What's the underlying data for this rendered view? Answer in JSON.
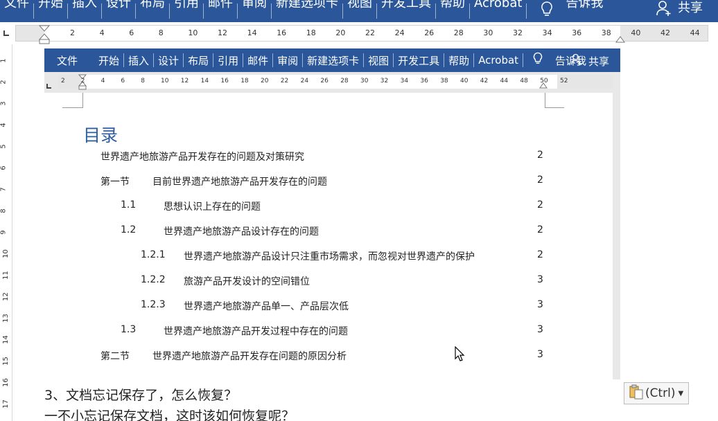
{
  "outer_ribbon": {
    "tabs": [
      "文件",
      "开始",
      "插入",
      "设计",
      "布局",
      "引用",
      "邮件",
      "审阅",
      "新建选项卡",
      "视图",
      "开发工具",
      "帮助",
      "Acrobat"
    ],
    "tell_me": "告诉我",
    "share": "共享",
    "bg_color": "#2b579a"
  },
  "outer_ruler": {
    "h_numbers": [
      "2",
      "4",
      "6",
      "8",
      "10",
      "12",
      "14",
      "16",
      "18",
      "20",
      "22",
      "24",
      "26",
      "28",
      "30",
      "32",
      "34",
      "36",
      "38",
      "40",
      "42",
      "44"
    ],
    "v_numbers": [
      "1",
      "2",
      "3",
      "4",
      "5",
      "6",
      "7",
      "8",
      "9",
      "10",
      "11",
      "12",
      "13",
      "14",
      "15",
      "16",
      "17"
    ]
  },
  "inner_ribbon": {
    "tabs": [
      "文件",
      "开始",
      "插入",
      "设计",
      "布局",
      "引用",
      "邮件",
      "审阅",
      "新建选项卡",
      "视图",
      "开发工具",
      "帮助",
      "Acrobat"
    ],
    "tell_me": "告诉我",
    "share": "共享"
  },
  "inner_ruler": {
    "numbers": [
      "2",
      "2",
      "4",
      "6",
      "8",
      "10",
      "12",
      "14",
      "16",
      "18",
      "20",
      "22",
      "24",
      "26",
      "28",
      "30",
      "32",
      "34",
      "36",
      "38",
      "40",
      "42",
      "44",
      "48",
      "50",
      "52"
    ]
  },
  "toc": {
    "title": "目录",
    "title_color": "#2e5fa3",
    "entries": [
      {
        "num": "",
        "text": "世界遗产地旅游产品开发存在的问题及对策研究",
        "page": "2"
      },
      {
        "num": "第一节",
        "text": "目前世界遗产地旅游产品开发存在的问题",
        "page": "2"
      },
      {
        "num": "1.1",
        "text": "思想认识上存在的问题",
        "page": "2"
      },
      {
        "num": "1.2",
        "text": "世界遗产地旅游产品设计存在的问题",
        "page": "2"
      },
      {
        "num": "1.2.1",
        "text": "世界遗产地旅游产品设计只注重市场需求，而忽视对世界遗产的保护",
        "page": "2"
      },
      {
        "num": "1.2.2",
        "text": "旅游产品开发设计的空间错位",
        "page": "3"
      },
      {
        "num": "1.2.3",
        "text": "世界遗产地旅游产品单一、产品层次低",
        "page": "3"
      },
      {
        "num": "1.3",
        "text": "世界遗产地旅游产品开发过程中存在的问题",
        "page": "3"
      },
      {
        "num": "第二节",
        "text": "世界遗产地旅游产品开发存在问题的原因分析",
        "page": "3"
      }
    ]
  },
  "article": {
    "line1": "3、文档忘记保存了，怎么恢复？",
    "line2": "一不小忘记保存文档，这时该如何恢复呢？"
  },
  "paste_options": {
    "label": "(Ctrl)",
    "icon": "clipboard-icon"
  }
}
